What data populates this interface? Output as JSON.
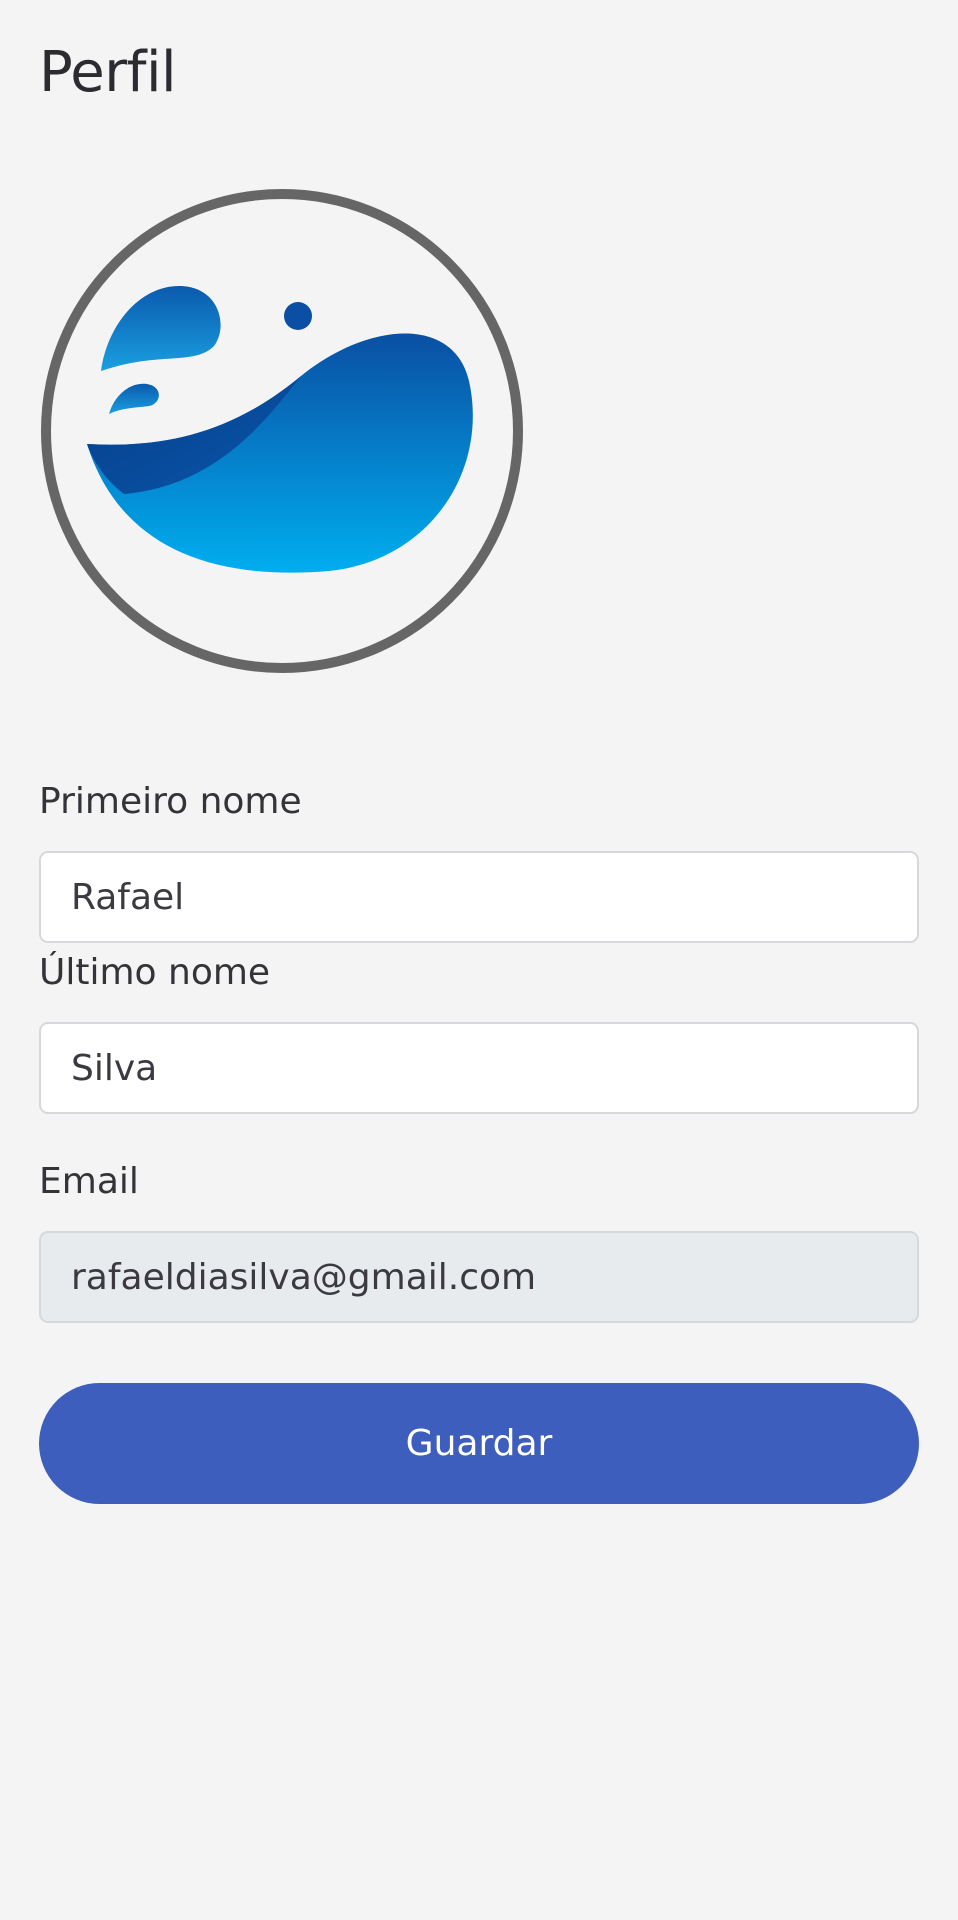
{
  "page": {
    "title": "Perfil"
  },
  "avatar": {
    "icon": "water-wave-logo",
    "ring_color": "#666666",
    "water_colors": [
      "#0a4fa3",
      "#00aeef"
    ]
  },
  "form": {
    "first_name": {
      "label": "Primeiro nome",
      "value": "Rafael"
    },
    "last_name": {
      "label": "Último nome",
      "value": "Silva"
    },
    "email": {
      "label": "Email",
      "value": "rafaeldiasilva@gmail.com",
      "readonly": true
    }
  },
  "actions": {
    "save_label": "Guardar",
    "save_color": "#3e5ebd"
  }
}
